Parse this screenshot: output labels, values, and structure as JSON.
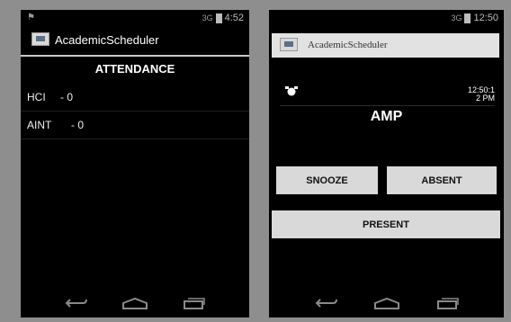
{
  "left_phone": {
    "status": {
      "time": "4:52",
      "signal": "3G"
    },
    "app_title": "AcademicScheduler",
    "section_title": "ATTENDANCE",
    "rows": [
      {
        "name": "HCI",
        "value": "- 0"
      },
      {
        "name": "AINT",
        "value": "- 0"
      }
    ]
  },
  "right_phone": {
    "status": {
      "time": "12:50",
      "signal": "3G"
    },
    "app_title": "AcademicScheduler",
    "clock_line1": "12:50:1",
    "clock_line2": "2 PM",
    "course": "AMP",
    "buttons": {
      "snooze": "SNOOZE",
      "absent": "ABSENT",
      "present": "PRESENT"
    }
  },
  "icons": [
    "back-icon",
    "home-icon",
    "recent-apps-icon",
    "alarm-icon",
    "app-icon",
    "battery-icon",
    "signal-icon"
  ]
}
